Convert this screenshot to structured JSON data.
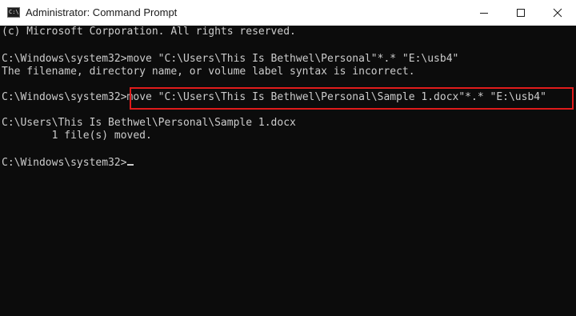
{
  "window": {
    "title": "Administrator: Command Prompt",
    "icon": "cmd-icon",
    "icon_text": "C:\\"
  },
  "controls": {
    "minimize": "minimize-icon",
    "maximize": "maximize-icon",
    "close": "close-icon"
  },
  "console": {
    "copyright": "(c) Microsoft Corporation. All rights reserved.",
    "prompt": "C:\\Windows\\system32>",
    "command1": "move \"C:\\Users\\This Is Bethwel\\Personal\"*.* \"E:\\usb4\"",
    "error1": "The filename, directory name, or volume label syntax is incorrect.",
    "command2": "move \"C:\\Users\\This Is Bethwel\\Personal\\Sample 1.docx\"*.* \"E:\\usb4\"",
    "moved_path": "C:\\Users\\This Is Bethwel\\Personal\\Sample 1.docx",
    "moved_result": "        1 file(s) moved."
  },
  "colors": {
    "console_bg": "#0c0c0c",
    "console_text": "#cccccc",
    "highlight": "#e01b1b"
  }
}
